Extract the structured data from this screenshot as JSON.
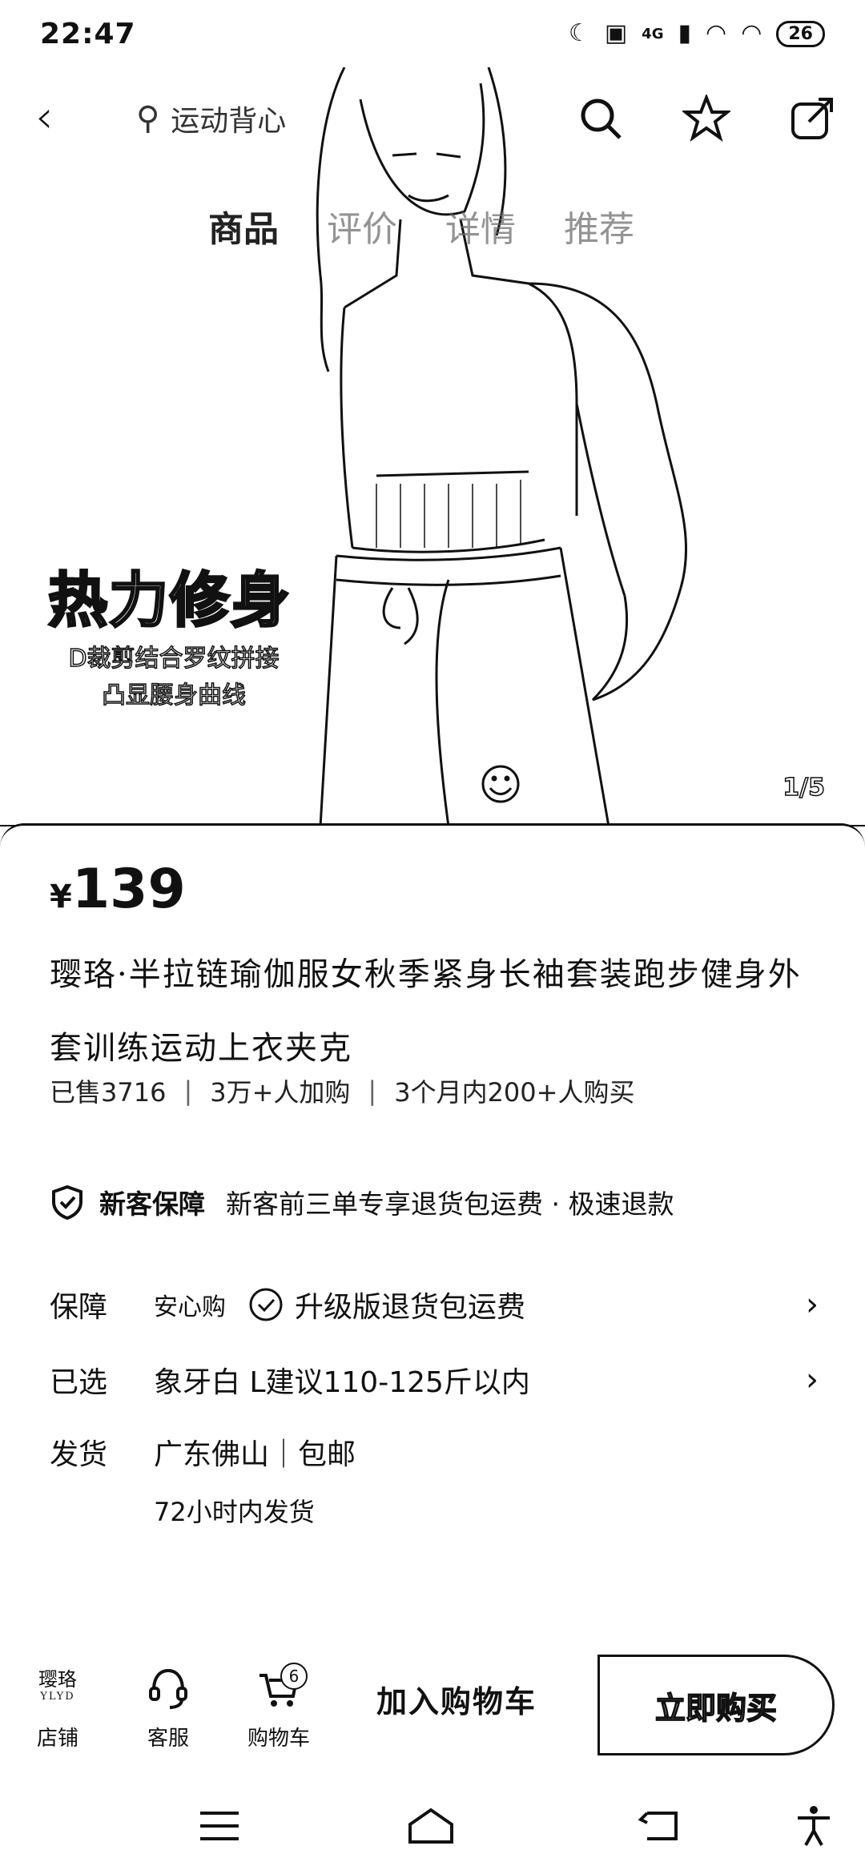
{
  "status_bar": {
    "time": "22:47",
    "network": "4G",
    "battery": "26"
  },
  "header": {
    "search_text": "运动背心",
    "tabs": [
      {
        "label": "商品",
        "active": true
      },
      {
        "label": "评价",
        "active": false
      },
      {
        "label": "详情",
        "active": false
      },
      {
        "label": "推荐",
        "active": false
      }
    ]
  },
  "hero": {
    "headline": "热力修身",
    "subline_1": "D裁剪结合罗纹拼接",
    "subline_2": "凸显腰身曲线",
    "page_indicator": "1/5"
  },
  "product": {
    "currency": "¥",
    "price": "139",
    "title": "璎珞·半拉链瑜伽服女秋季紧身长袖套装跑步健身外套训练运动上衣夹克",
    "sold": "已售3716",
    "added_to_cart": "3万+人加购",
    "recent_buyers": "3个月内200+人购买"
  },
  "guarantee": {
    "name": "新客保障",
    "desc": "新客前三单专享退货包运费 · 极速退款"
  },
  "rows": {
    "protection_label": "保障",
    "protection_badge": "安心购",
    "protection_desc": "升级版退货包运费",
    "selected_label": "已选",
    "selected_value": "象牙白 L建议110-125斤以内",
    "shipping_label": "发货",
    "shipping_value": "广东佛山｜包邮",
    "shipping_time": "72小时内发货"
  },
  "action_bar": {
    "shop_logo": "璎珞",
    "shop_logo_sub": "YLYD",
    "shop_label": "店铺",
    "service_label": "客服",
    "cart_label": "购物车",
    "cart_count": "6",
    "add_to_cart": "加入购物车",
    "buy_now": "立即购买"
  }
}
